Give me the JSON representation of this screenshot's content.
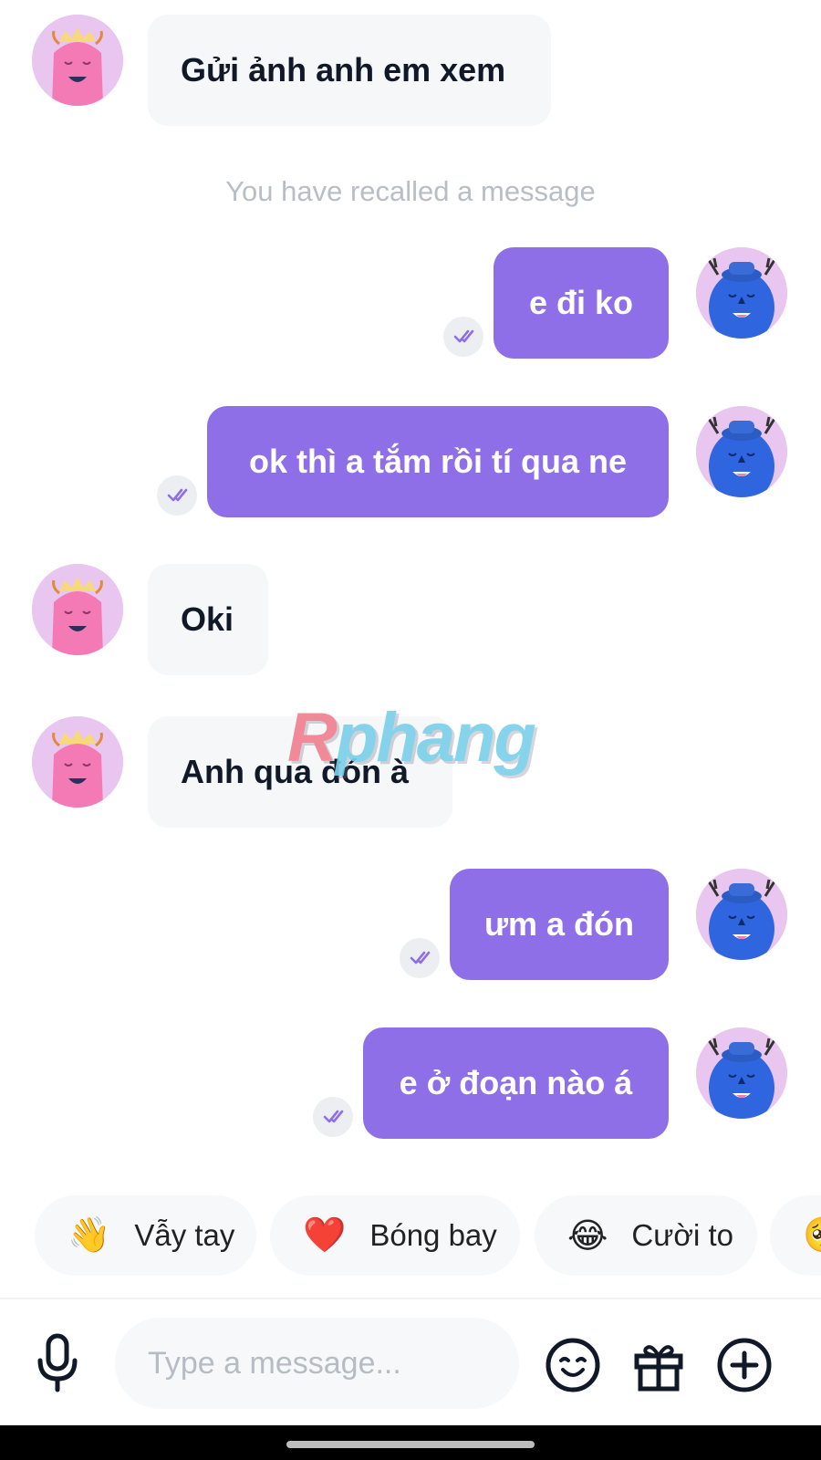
{
  "chat": {
    "system_notice": "You have recalled a message",
    "messages": [
      {
        "text": "Gửi ảnh anh em xem"
      },
      {
        "text": "e đi ko"
      },
      {
        "text": "ok thì a tắm rồi tí qua ne"
      },
      {
        "text": "Oki"
      },
      {
        "text": "Anh qua đón à"
      },
      {
        "text": "ưm a đón"
      },
      {
        "text": "e ở đoạn nào á"
      }
    ]
  },
  "watermark": {
    "first": "R",
    "rest": "phang"
  },
  "reactions": [
    {
      "emoji": "👋",
      "label": "Vẫy tay"
    },
    {
      "emoji": "❤️",
      "label": "Bóng bay"
    },
    {
      "emoji": "😂",
      "label": "Cười to"
    },
    {
      "emoji": "🥺",
      "label": ""
    }
  ],
  "composer": {
    "placeholder": "Type a message...",
    "icons": [
      "microphone-icon",
      "emoji-icon",
      "gift-icon",
      "plus-icon"
    ]
  },
  "colors": {
    "outgoing_bubble": "#8f6fe8",
    "incoming_bubble": "#f5f7f8",
    "read_check": "#8f6fe8",
    "avatar_bg": "#e9c6f0"
  }
}
